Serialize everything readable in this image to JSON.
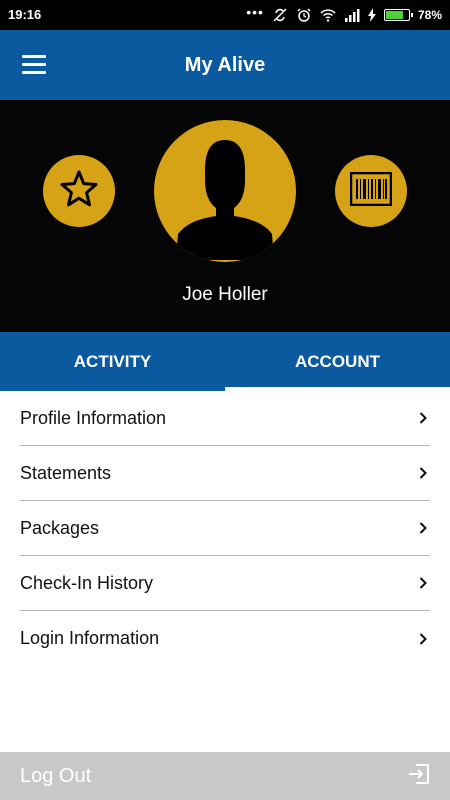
{
  "status_bar": {
    "time": "19:16",
    "battery_percent": "78%",
    "battery_level": 0.78
  },
  "app_bar": {
    "title": "My Alive",
    "menu_icon": "hamburger-menu-icon"
  },
  "profile": {
    "name": "Joe Holler",
    "left_button_icon": "star-icon",
    "right_button_icon": "barcode-icon",
    "avatar_icon": "user-silhouette-icon"
  },
  "tabs": [
    {
      "label": "ACTIVITY",
      "active": false
    },
    {
      "label": "ACCOUNT",
      "active": true
    }
  ],
  "menu": {
    "items": [
      {
        "label": "Profile Information"
      },
      {
        "label": "Statements"
      },
      {
        "label": "Packages"
      },
      {
        "label": "Check-In History"
      },
      {
        "label": "Login Information"
      }
    ]
  },
  "logout": {
    "label": "Log Out",
    "icon": "exit-icon"
  },
  "colors": {
    "primary_blue": "#0b5aa0",
    "gold": "#d6a317",
    "header_black": "#050505",
    "logout_gray": "#c8c8c8"
  }
}
